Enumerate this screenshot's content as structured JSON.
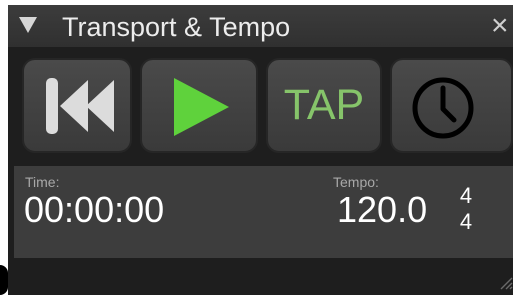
{
  "panel": {
    "title": "Transport & Tempo",
    "close_glyph": "×"
  },
  "icons": {
    "collapse": "triangle-down",
    "rewind": "skip-to-start",
    "play": "play",
    "tempo": "clock"
  },
  "buttons": {
    "rewind": {
      "icon": "skip-to-start"
    },
    "play": {
      "icon": "play"
    },
    "tap": {
      "label": "TAP"
    },
    "clock": {
      "icon": "clock"
    }
  },
  "display": {
    "time_label": "Time:",
    "time_value": "00:00:00",
    "tempo_label": "Tempo:",
    "tempo_value": "120.0",
    "time_signature": {
      "numerator": "4",
      "denominator": "4"
    }
  },
  "colors": {
    "accent_green": "#86c46a",
    "play_green": "#5fd23c",
    "panel_bg": "#1e1e1e",
    "display_bg": "#3d3d3d"
  }
}
